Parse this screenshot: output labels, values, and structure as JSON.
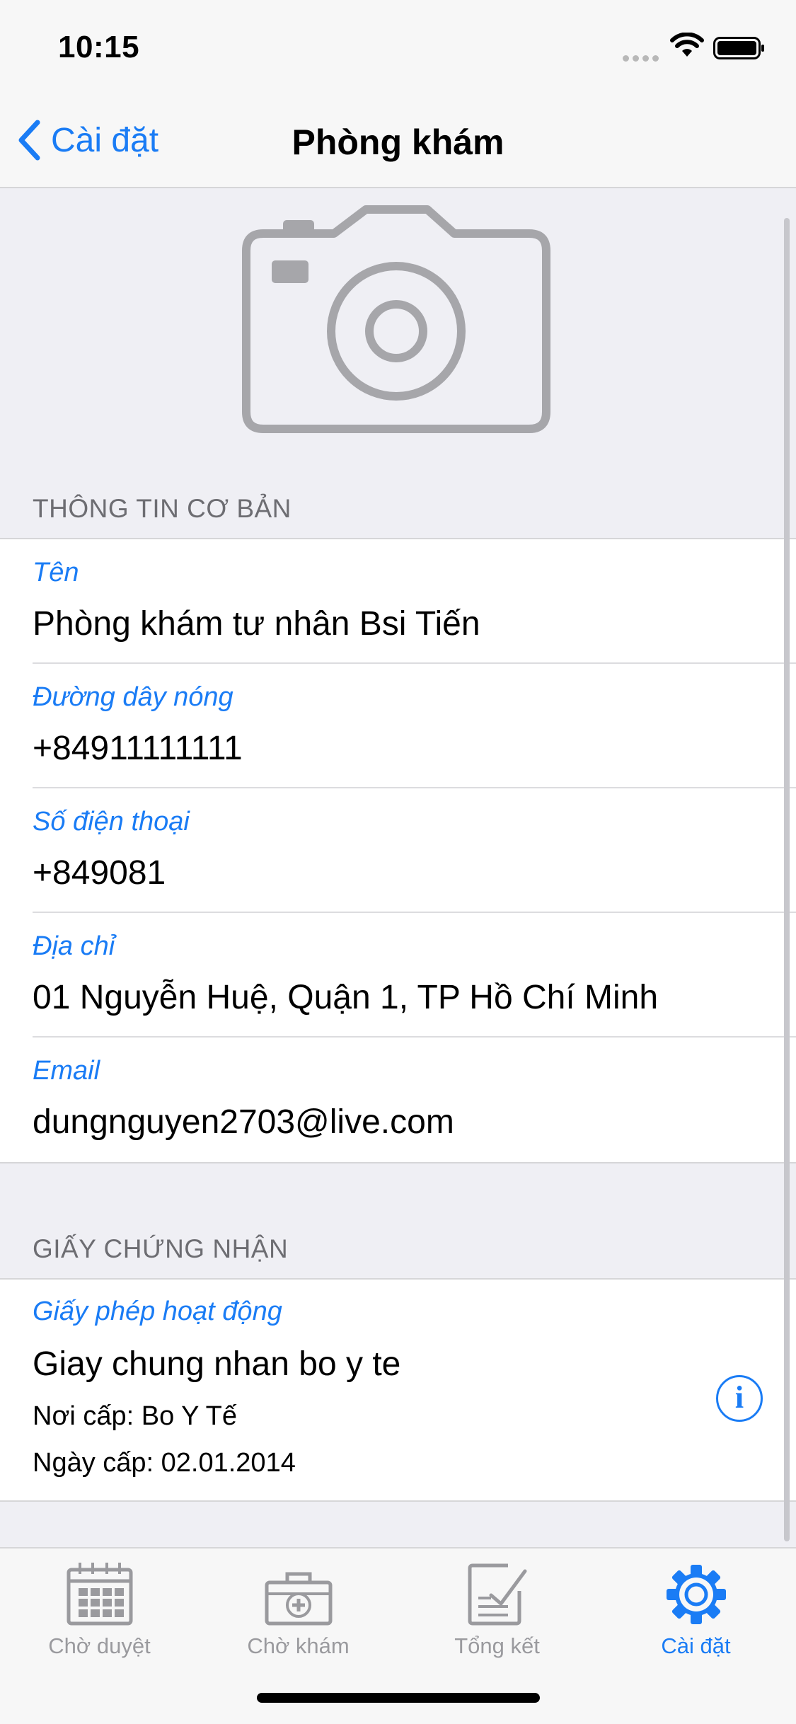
{
  "status_bar": {
    "time": "10:15"
  },
  "nav": {
    "back_label": "Cài đặt",
    "title": "Phòng khám"
  },
  "sections": {
    "basic": {
      "header": "THÔNG TIN CƠ BẢN",
      "fields": [
        {
          "label": "Tên",
          "value": "Phòng khám tư nhân Bsi Tiến"
        },
        {
          "label": "Đường dây nóng",
          "value": "+84911111111"
        },
        {
          "label": "Số điện thoại",
          "value": "+849081"
        },
        {
          "label": "Địa chỉ",
          "value": "01 Nguyễn Huệ, Quận 1, TP Hồ Chí Minh"
        },
        {
          "label": "Email",
          "value": "dungnguyen2703@live.com"
        }
      ]
    },
    "certificate": {
      "header": "GIẤY CHỨNG NHẬN",
      "label": "Giấy phép hoạt động",
      "value": "Giay chung nhan bo y te",
      "issuer": "Nơi cấp: Bo Y Tế",
      "issue_date": "Ngày cấp: 02.01.2014",
      "info_glyph": "i"
    }
  },
  "tabs": [
    {
      "label": "Chờ duyệt",
      "icon": "calendar-icon"
    },
    {
      "label": "Chờ khám",
      "icon": "medical-kit-icon"
    },
    {
      "label": "Tổng kết",
      "icon": "checklist-icon"
    },
    {
      "label": "Cài đặt",
      "icon": "gear-icon",
      "active": true
    }
  ],
  "colors": {
    "accent": "#1a7cf5",
    "inactive": "#9a9a9e",
    "background": "#efeff4"
  }
}
